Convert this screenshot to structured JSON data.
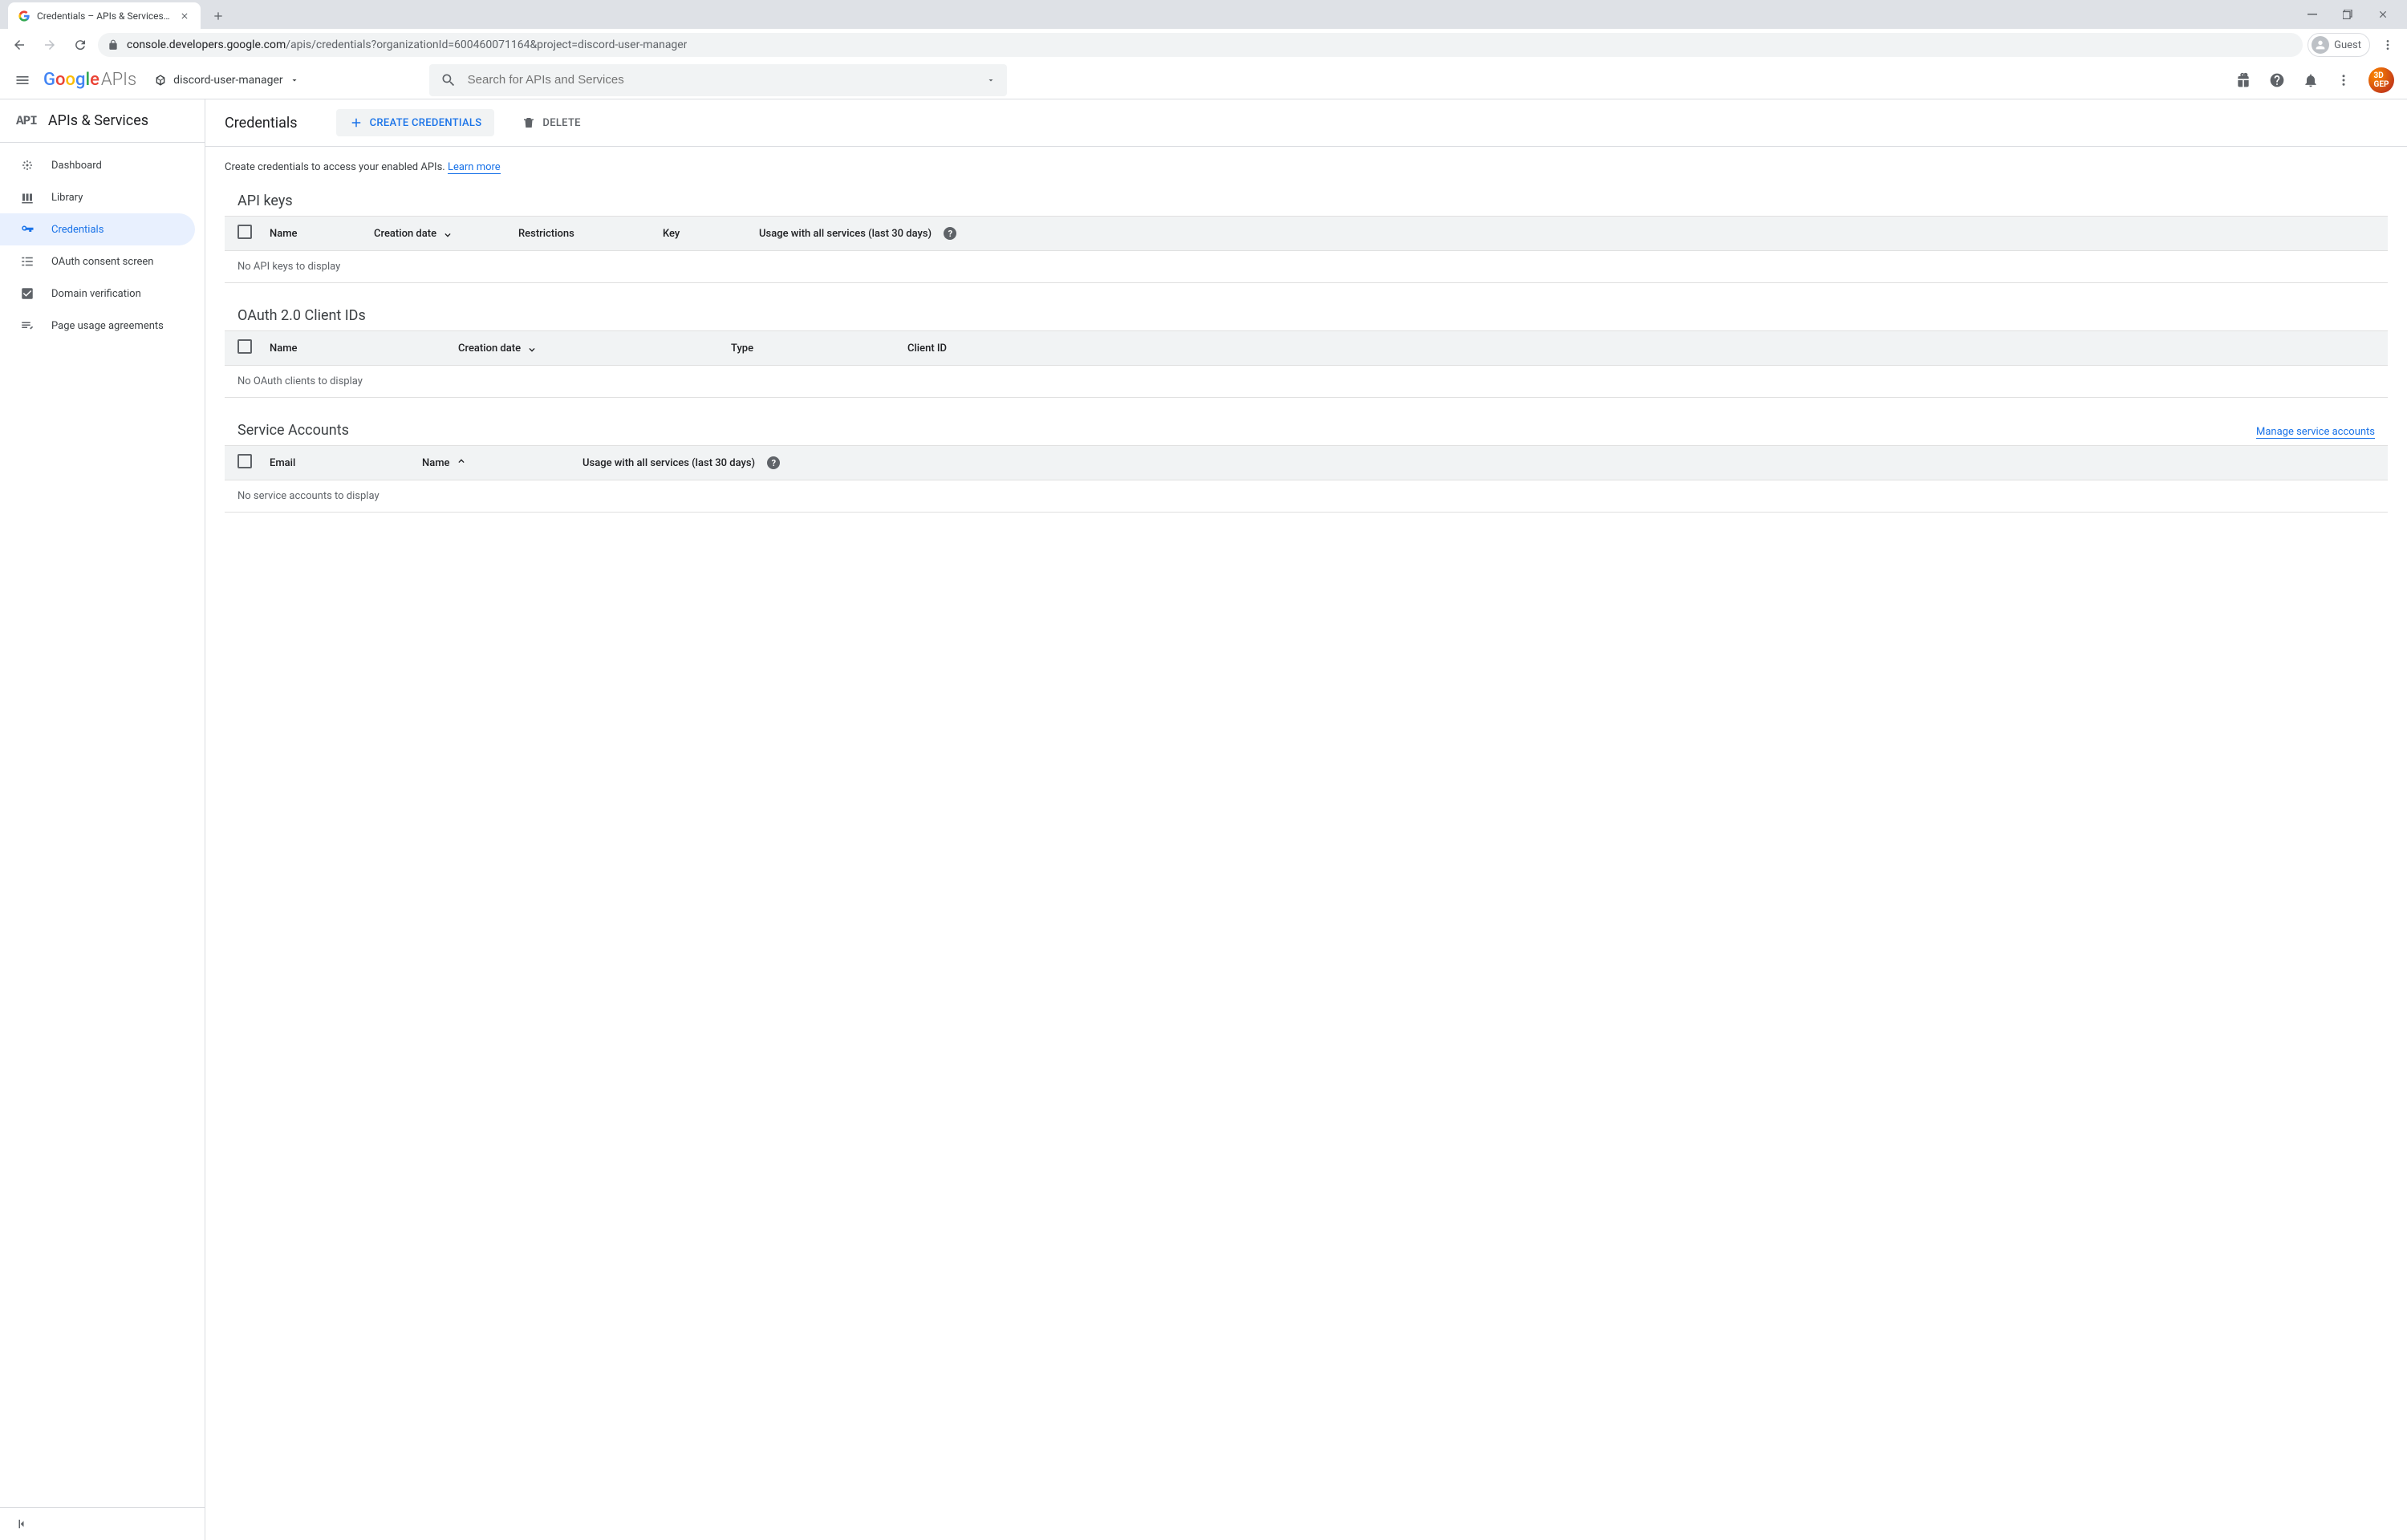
{
  "browser": {
    "tab_title": "Credentials – APIs & Services – d",
    "url_host": "console.developers.google.com",
    "url_path": "/apis/credentials?organizationId=600460071164&project=discord-user-manager",
    "guest_label": "Guest"
  },
  "header": {
    "logo_suffix": "APIs",
    "project_name": "discord-user-manager",
    "search_placeholder": "Search for APIs and Services"
  },
  "sidebar": {
    "section_title": "APIs & Services",
    "items": [
      {
        "label": "Dashboard",
        "icon": "dashboard"
      },
      {
        "label": "Library",
        "icon": "library"
      },
      {
        "label": "Credentials",
        "icon": "key"
      },
      {
        "label": "OAuth consent screen",
        "icon": "consent"
      },
      {
        "label": "Domain verification",
        "icon": "verified"
      },
      {
        "label": "Page usage agreements",
        "icon": "agreement"
      }
    ],
    "active_index": 2
  },
  "page": {
    "title": "Credentials",
    "create_btn": "CREATE CREDENTIALS",
    "delete_btn": "DELETE",
    "intro_text": "Create credentials to access your enabled APIs. ",
    "intro_link": "Learn more"
  },
  "sections": {
    "api_keys": {
      "title": "API keys",
      "columns": [
        "Name",
        "Creation date",
        "Restrictions",
        "Key",
        "Usage with all services (last 30 days)"
      ],
      "sort_col_index": 1,
      "sort_dir": "desc",
      "help_col_index": 4,
      "empty": "No API keys to display",
      "rows": []
    },
    "oauth": {
      "title": "OAuth 2.0 Client IDs",
      "columns": [
        "Name",
        "Creation date",
        "Type",
        "Client ID"
      ],
      "sort_col_index": 1,
      "sort_dir": "desc",
      "empty": "No OAuth clients to display",
      "rows": []
    },
    "service_accounts": {
      "title": "Service Accounts",
      "manage_link": "Manage service accounts",
      "columns": [
        "Email",
        "Name",
        "Usage with all services (last 30 days)"
      ],
      "sort_col_index": 1,
      "sort_dir": "asc",
      "help_col_index": 2,
      "empty": "No service accounts to display",
      "rows": []
    }
  }
}
